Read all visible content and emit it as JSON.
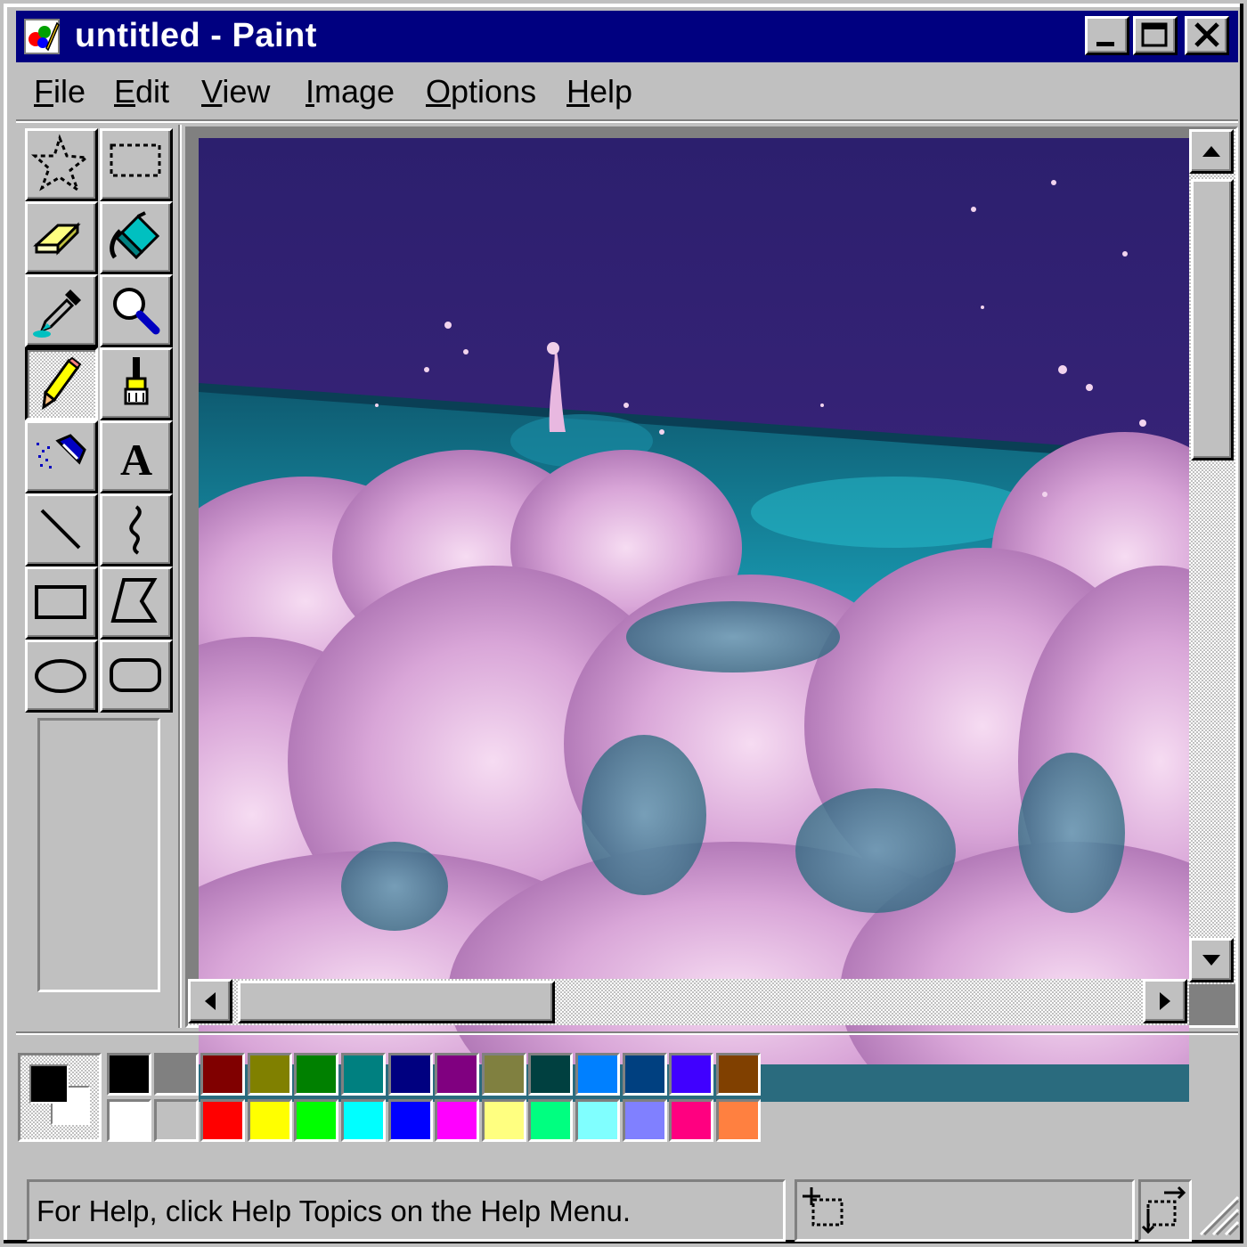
{
  "window": {
    "title": "untitled - Paint",
    "controls": [
      "minimize-icon",
      "maximize-icon",
      "close-icon"
    ]
  },
  "menu": [
    {
      "label": "File",
      "accel": "F",
      "rest": "ile"
    },
    {
      "label": "Edit",
      "accel": "E",
      "rest": "dit"
    },
    {
      "label": "View",
      "accel": "V",
      "rest": "iew"
    },
    {
      "label": "Image",
      "accel": "I",
      "rest": "mage"
    },
    {
      "label": "Options",
      "accel": "O",
      "rest": "ptions"
    },
    {
      "label": "Help",
      "accel": "H",
      "rest": "elp"
    }
  ],
  "tools": [
    {
      "name": "free-form-select",
      "icon": "star-select-icon"
    },
    {
      "name": "select",
      "icon": "rect-select-icon"
    },
    {
      "name": "eraser",
      "icon": "eraser-icon"
    },
    {
      "name": "fill-with-color",
      "icon": "paint-bucket-icon"
    },
    {
      "name": "pick-color",
      "icon": "eyedropper-icon"
    },
    {
      "name": "magnifier",
      "icon": "magnifier-icon"
    },
    {
      "name": "pencil",
      "icon": "pencil-icon",
      "selected": true
    },
    {
      "name": "brush",
      "icon": "brush-icon"
    },
    {
      "name": "airbrush",
      "icon": "airbrush-icon"
    },
    {
      "name": "text",
      "icon": "text-icon",
      "glyph": "A"
    },
    {
      "name": "line",
      "icon": "line-icon"
    },
    {
      "name": "curve",
      "icon": "curve-icon"
    },
    {
      "name": "rectangle",
      "icon": "rectangle-icon"
    },
    {
      "name": "polygon",
      "icon": "polygon-icon"
    },
    {
      "name": "ellipse",
      "icon": "ellipse-icon"
    },
    {
      "name": "rounded-rectangle",
      "icon": "rounded-rectangle-icon"
    }
  ],
  "colors": {
    "foreground": "#000000",
    "background": "#ffffff",
    "palette_top": [
      "#000000",
      "#808080",
      "#800000",
      "#808000",
      "#008000",
      "#008080",
      "#000080",
      "#800080",
      "#808040",
      "#004040",
      "#0080ff",
      "#004080",
      "#4000ff",
      "#804000"
    ],
    "palette_bottom": [
      "#ffffff",
      "#c0c0c0",
      "#ff0000",
      "#ffff00",
      "#00ff00",
      "#00ffff",
      "#0000ff",
      "#ff00ff",
      "#ffff80",
      "#00ff80",
      "#80ffff",
      "#8080ff",
      "#ff0080",
      "#ff8040"
    ]
  },
  "status": {
    "help_text": "For Help, click Help Topics on the Help Menu."
  },
  "theme": {
    "title_bar": "#000080",
    "face": "#c0c0c0"
  }
}
